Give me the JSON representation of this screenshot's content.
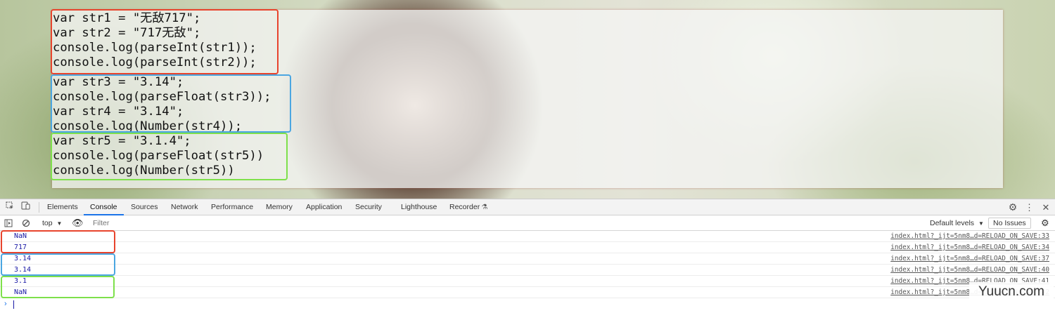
{
  "code": {
    "red_lines": [
      "var str1 = \"无敌717\";",
      "var str2 = \"717无敌\";",
      "console.log(parseInt(str1));",
      "console.log(parseInt(str2));"
    ],
    "blue_lines": [
      "var str3 = \"3.14\";",
      "console.log(parseFloat(str3));",
      "var str4 = \"3.14\";",
      "console.log(Number(str4));"
    ],
    "green_lines": [
      "var str5 = \"3.1.4\";",
      "console.log(parseFloat(str5))",
      "console.log(Number(str5))"
    ]
  },
  "devtools": {
    "tabs": [
      {
        "label": "Elements"
      },
      {
        "label": "Console",
        "active": true
      },
      {
        "label": "Sources"
      },
      {
        "label": "Network"
      },
      {
        "label": "Performance"
      },
      {
        "label": "Memory"
      },
      {
        "label": "Application"
      },
      {
        "label": "Security"
      },
      {
        "label": "Lighthouse"
      },
      {
        "label": "Recorder"
      }
    ],
    "recorder_icon": "flask-icon",
    "toolbar": {
      "context": "top",
      "filter_placeholder": "Filter",
      "levels": "Default levels",
      "issues": "No Issues"
    },
    "console_rows": [
      {
        "value": "NaN",
        "source": "index.html?_ijt=5nm8…d=RELOAD_ON_SAVE:33"
      },
      {
        "value": "717",
        "source": "index.html?_ijt=5nm8…d=RELOAD_ON_SAVE:34"
      },
      {
        "value": "3.14",
        "source": "index.html?_ijt=5nm8…d=RELOAD_ON_SAVE:37"
      },
      {
        "value": "3.14",
        "source": "index.html?_ijt=5nm8…d=RELOAD_ON_SAVE:40"
      },
      {
        "value": "3.1",
        "source": "index.html?_ijt=5nm8…d=RELOAD_ON_SAVE:41"
      },
      {
        "value": "NaN",
        "source": "index.html?_ijt=5nm8…d=RELOAD_ON_SAVE:42"
      }
    ],
    "highlight_colors": {
      "red": "#e8442d",
      "blue": "#4ba6e1",
      "green": "#7ee04b"
    }
  },
  "watermark": "Yuucn.com"
}
